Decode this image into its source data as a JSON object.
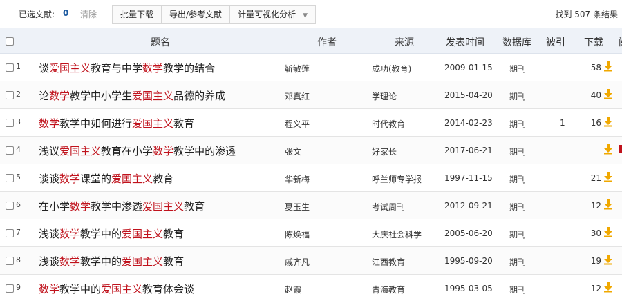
{
  "toolbar": {
    "selected_label": "已选文献:",
    "selected_count": "0",
    "clear_label": "清除",
    "buttons": [
      "批量下载",
      "导出/参考文献",
      "计量可视化分析"
    ],
    "result_count": "找到 507 条结果"
  },
  "table": {
    "headers": {
      "title": "题名",
      "author": "作者",
      "source": "来源",
      "date": "发表时间",
      "database": "数据库",
      "cited": "被引",
      "download": "下载",
      "extra": "阅"
    },
    "rows": [
      {
        "index": "1",
        "title": [
          [
            "谈",
            0
          ],
          [
            "爱国主义",
            1
          ],
          [
            "教育与中学",
            0
          ],
          [
            "数学",
            1
          ],
          [
            "教学的结合",
            0
          ]
        ],
        "author": "靳敏莲",
        "source": "成功(教育)",
        "date": "2009-01-15",
        "database": "期刊",
        "cited": "",
        "downloads": "58"
      },
      {
        "index": "2",
        "title": [
          [
            "论",
            0
          ],
          [
            "数学",
            1
          ],
          [
            "教学中小学生",
            0
          ],
          [
            "爱国主义",
            1
          ],
          [
            "品德的养成",
            0
          ]
        ],
        "author": "邓真红",
        "source": "学理论",
        "date": "2015-04-20",
        "database": "期刊",
        "cited": "",
        "downloads": "40"
      },
      {
        "index": "3",
        "title": [
          [
            "数学",
            1
          ],
          [
            "教学中如何进行",
            0
          ],
          [
            "爱国主义",
            1
          ],
          [
            "教育",
            0
          ]
        ],
        "author": "程义平",
        "source": "时代教育",
        "date": "2014-02-23",
        "database": "期刊",
        "cited": "1",
        "downloads": "16"
      },
      {
        "index": "4",
        "title": [
          [
            "浅议",
            0
          ],
          [
            "爱国主义",
            1
          ],
          [
            "教育在小学",
            0
          ],
          [
            "数学",
            1
          ],
          [
            "教学中的渗透",
            0
          ]
        ],
        "author": "张文",
        "source": "好家长",
        "date": "2017-06-21",
        "database": "期刊",
        "cited": "",
        "downloads": ""
      },
      {
        "index": "5",
        "title": [
          [
            "谈谈",
            0
          ],
          [
            "数学",
            1
          ],
          [
            "课堂的",
            0
          ],
          [
            "爱国主义",
            1
          ],
          [
            "教育",
            0
          ]
        ],
        "author": "华新梅",
        "source": "呼兰师专学报",
        "date": "1997-11-15",
        "database": "期刊",
        "cited": "",
        "downloads": "21"
      },
      {
        "index": "6",
        "title": [
          [
            "在小学",
            0
          ],
          [
            "数学",
            1
          ],
          [
            "教学中渗透",
            0
          ],
          [
            "爱国主义",
            1
          ],
          [
            "教育",
            0
          ]
        ],
        "author": "夏玉生",
        "source": "考试周刊",
        "date": "2012-09-21",
        "database": "期刊",
        "cited": "",
        "downloads": "12"
      },
      {
        "index": "7",
        "title": [
          [
            "浅谈",
            0
          ],
          [
            "数学",
            1
          ],
          [
            "教学中的",
            0
          ],
          [
            "爱国主义",
            1
          ],
          [
            "教育",
            0
          ]
        ],
        "author": "陈焕福",
        "source": "大庆社会科学",
        "date": "2005-06-20",
        "database": "期刊",
        "cited": "",
        "downloads": "30"
      },
      {
        "index": "8",
        "title": [
          [
            "浅谈",
            0
          ],
          [
            "数学",
            1
          ],
          [
            "教学中的",
            0
          ],
          [
            "爱国主义",
            1
          ],
          [
            "教育",
            0
          ]
        ],
        "author": "戚齐凡",
        "source": "江西教育",
        "date": "1995-09-20",
        "database": "期刊",
        "cited": "",
        "downloads": "19"
      },
      {
        "index": "9",
        "title": [
          [
            "数学",
            1
          ],
          [
            "教学中的",
            0
          ],
          [
            "爱国主义",
            1
          ],
          [
            "教育体会谈",
            0
          ]
        ],
        "author": "赵霞",
        "source": "青海教育",
        "date": "1995-03-05",
        "database": "期刊",
        "cited": "",
        "downloads": "12"
      }
    ]
  },
  "colors": {
    "highlight": "#c0121c",
    "header_bg": "#eef2f8",
    "download_icon": "#f0a800",
    "count_blue": "#1d5aa0"
  },
  "icons": {
    "download": "download-arrow-icon",
    "checkbox": "checkbox",
    "dropdown": "chevron-down-icon"
  }
}
